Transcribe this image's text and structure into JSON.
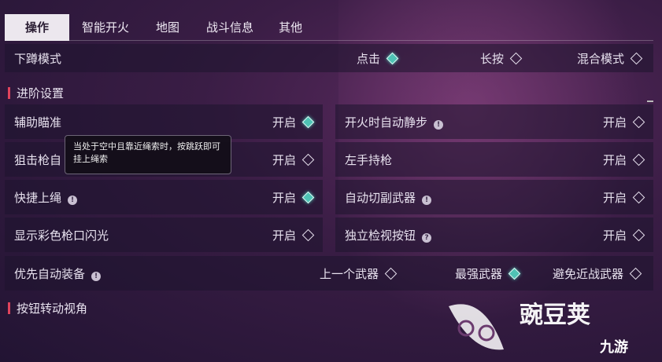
{
  "tabs": [
    "操作",
    "智能开火",
    "地图",
    "战斗信息",
    "其他"
  ],
  "crouch": {
    "label": "下蹲模式",
    "options": [
      {
        "label": "点击",
        "on": true
      },
      {
        "label": "长按",
        "on": false
      },
      {
        "label": "混合模式",
        "on": false
      }
    ]
  },
  "advanced": {
    "title": "进阶设置"
  },
  "left_rows": [
    {
      "label": "辅助瞄准",
      "value": "开启",
      "on": true,
      "info": false
    },
    {
      "label": "狙击枪自",
      "value": "开启",
      "on": false,
      "info": false
    },
    {
      "label": "快捷上绳",
      "value": "开启",
      "on": true,
      "info": true
    },
    {
      "label": "显示彩色枪口闪光",
      "value": "开启",
      "on": false,
      "info": false
    }
  ],
  "right_rows": [
    {
      "label": "开火时自动静步",
      "value": "开启",
      "on": false,
      "info": "!"
    },
    {
      "label": "左手持枪",
      "value": "开启",
      "on": false,
      "info": ""
    },
    {
      "label": "自动切副武器",
      "value": "开启",
      "on": false,
      "info": "!"
    },
    {
      "label": "独立检视按钮",
      "value": "开启",
      "on": false,
      "info": "?"
    }
  ],
  "priority": {
    "label": "优先自动装备",
    "options": [
      {
        "label": "上一个武器",
        "on": false
      },
      {
        "label": "最强武器",
        "on": true
      },
      {
        "label": "避免近战武器",
        "on": false
      }
    ]
  },
  "tooltip": {
    "text": "当处于空中且靠近绳索时，按跳跃即可挂上绳索"
  },
  "bottom_section": {
    "title": "按钮转动视角"
  },
  "watermark": {
    "text": "豌豆荚",
    "brand": "九游"
  },
  "colors": {
    "accent": "#4fc3b5",
    "section_bar": "#e0435c"
  }
}
